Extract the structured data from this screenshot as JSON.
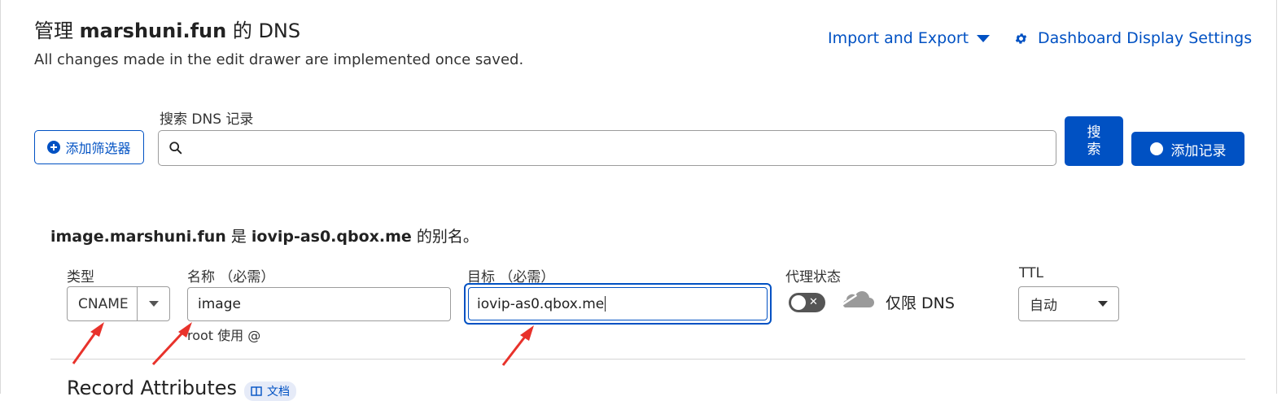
{
  "header": {
    "title_prefix": "管理",
    "domain": "marshuni.fun",
    "title_suffix": "的 DNS",
    "subtitle": "All changes made in the edit drawer are implemented once saved.",
    "import_export_label": "Import and Export",
    "dashboard_settings_label": "Dashboard Display Settings"
  },
  "search": {
    "label": "搜索 DNS 记录",
    "value": "",
    "add_filter_label": "添加筛选器",
    "search_button_label": "搜索",
    "add_record_label": "添加记录"
  },
  "record_form": {
    "alias_name": "image.marshuni.fun",
    "alias_connector": "是",
    "alias_target": "iovip-as0.qbox.me",
    "alias_suffix": "的别名。",
    "type_label": "类型",
    "type_value": "CNAME",
    "name_label": "名称 （必需）",
    "name_value": "image",
    "name_hint": "root 使用 @",
    "target_label": "目标 （必需）",
    "target_value": "iovip-as0.qbox.me",
    "proxy_label": "代理状态",
    "proxy_state_text": "仅限 DNS",
    "proxy_enabled": false,
    "ttl_label": "TTL",
    "ttl_value": "自动"
  },
  "attributes": {
    "title": "Record Attributes",
    "docs_badge": "文档"
  },
  "colors": {
    "accent": "#0051c3",
    "annotation_arrow": "#e8322b",
    "toggle_off": "#555555"
  }
}
